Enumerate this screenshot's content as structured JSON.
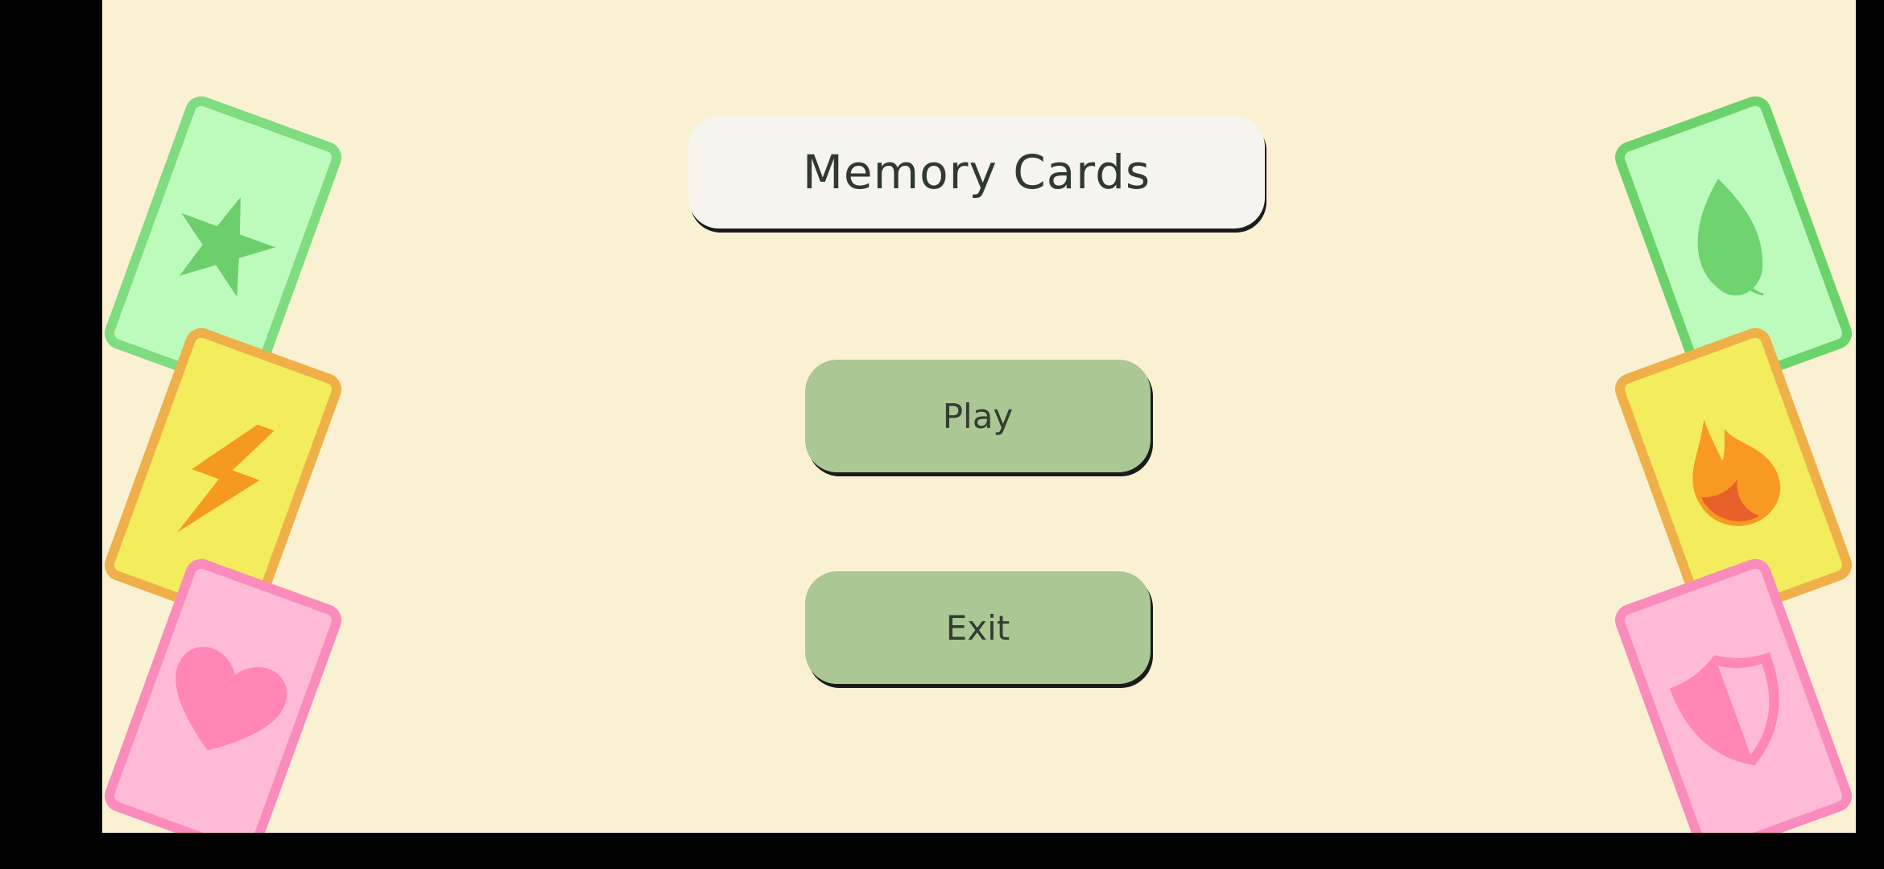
{
  "title": "Memory Cards",
  "menu": {
    "play_label": "Play",
    "exit_label": "Exit"
  },
  "colors": {
    "background": "#faf1d3",
    "letterbox": "#000000",
    "button_fill": "#abc794",
    "title_panel": "#f5f4ee",
    "card_green": "#bdfbbd",
    "card_yellow": "#f3ec5c",
    "card_pink": "#ffbad6"
  },
  "decor": {
    "left_cards": [
      "star-icon",
      "lightning-icon",
      "heart-icon"
    ],
    "right_cards": [
      "leaf-icon",
      "fire-icon",
      "shield-icon"
    ]
  }
}
